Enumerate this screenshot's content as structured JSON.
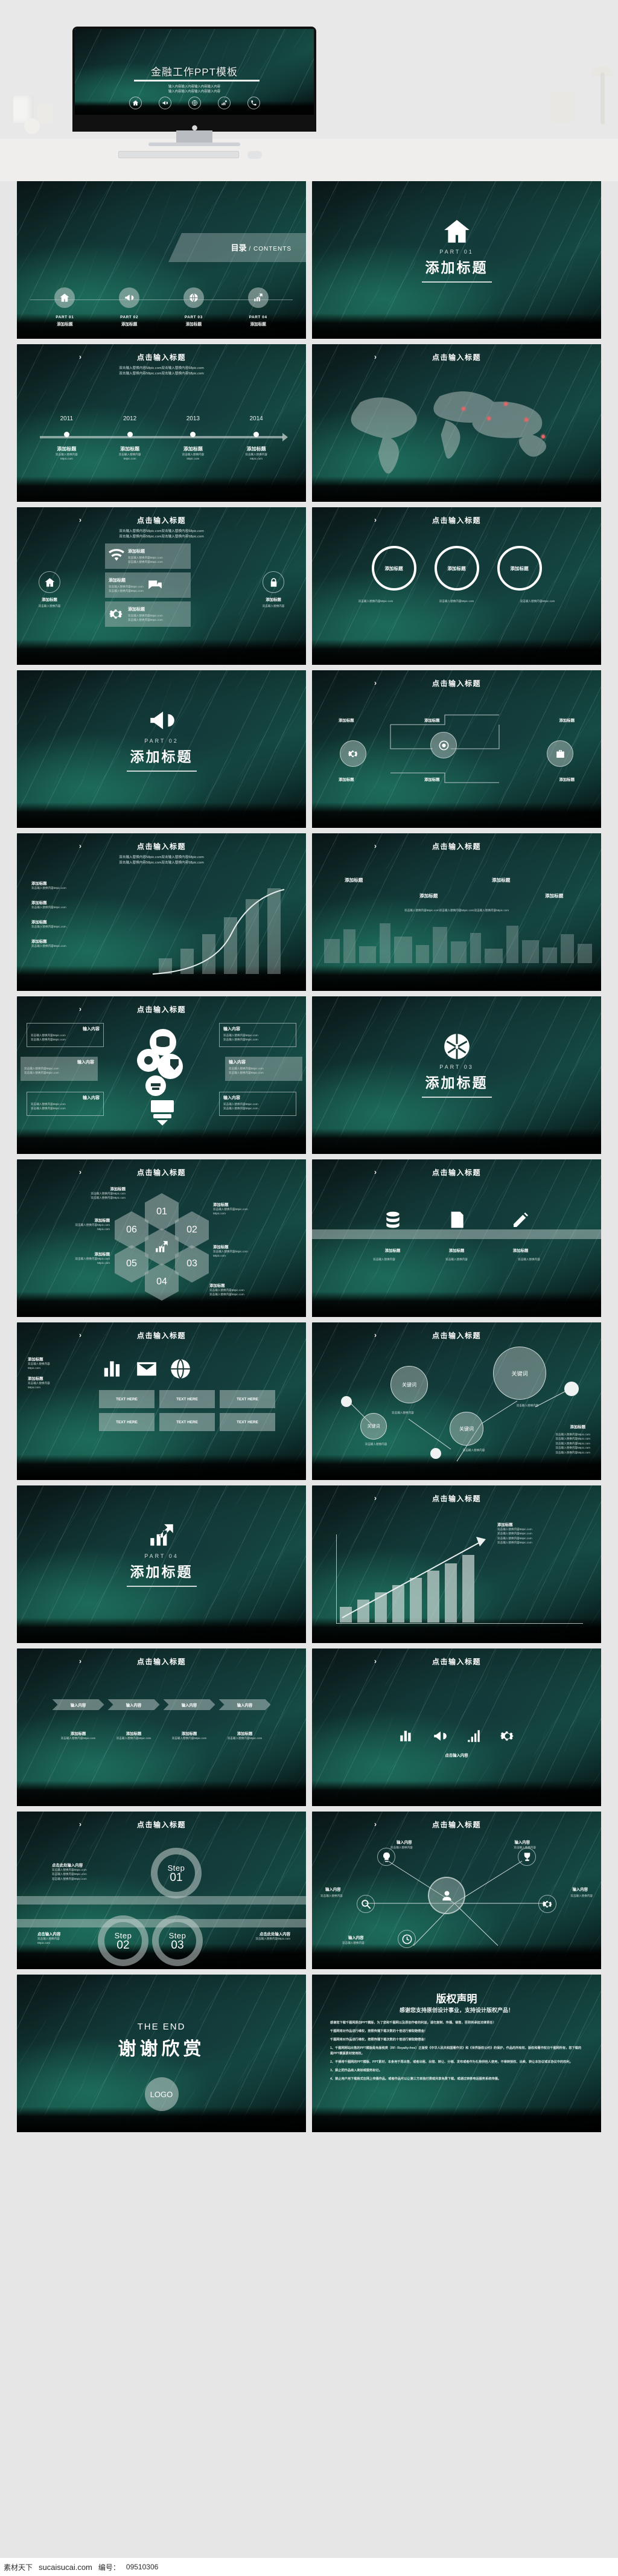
{
  "hero": {
    "title": "金融工作PPT模板",
    "subtitle_line1": "输入内容输入内容输入内容输入内容",
    "subtitle_line2": "输入内容输入内容输入内容输入内容",
    "icons": [
      "home-icon",
      "megaphone-icon",
      "network-globe-icon",
      "growth-chart-icon",
      "phone-icon"
    ]
  },
  "common": {
    "slide_title": "点击输入标题",
    "body_text": "双击输入替换内容58pic.com双击输入替换内容58pic.com",
    "body_text_short": "双击输入替换内容",
    "site": "58pic.com",
    "add_title": "添加标题",
    "input_content": "输入内容",
    "keyword": "关键词",
    "click_here_input": "点击此处输入内容",
    "click_input": "点击输入内容"
  },
  "contents": {
    "heading_cn": "目录",
    "heading_sep": " / ",
    "heading_en": "CONTENTS",
    "items": [
      {
        "part": "PART 01",
        "label": "添加标题",
        "icon": "home-icon"
      },
      {
        "part": "PART 02",
        "label": "添加标题",
        "icon": "megaphone-icon"
      },
      {
        "part": "PART 03",
        "label": "添加标题",
        "icon": "network-globe-icon"
      },
      {
        "part": "PART 04",
        "label": "添加标题",
        "icon": "growth-chart-icon"
      }
    ]
  },
  "sections": [
    {
      "part": "PART 01",
      "title": "添加标题",
      "icon": "home-icon"
    },
    {
      "part": "PART 02",
      "title": "添加标题",
      "icon": "megaphone-icon"
    },
    {
      "part": "PART 03",
      "title": "添加标题",
      "icon": "network-globe-icon"
    },
    {
      "part": "PART 04",
      "title": "添加标题",
      "icon": "growth-chart-icon"
    }
  ],
  "timeline": {
    "title": "点击输入标题",
    "sub1": "双击输入替换内容58pic.com双击输入替换内容58pic.com",
    "sub2": "双击输入替换内容58pic.com双击输入替换内容58pic.com",
    "years": [
      "2011",
      "2012",
      "2013",
      "2014"
    ],
    "labels": [
      "添加标题",
      "添加标题",
      "添加标题",
      "添加标题"
    ],
    "captions": [
      "双击输入替换内容",
      "双击输入替换内容",
      "双击输入替换内容",
      "双击输入替换内容"
    ]
  },
  "map_slide": {
    "title": "点击输入标题",
    "pins": 5
  },
  "three_circles": {
    "title": "点击输入标题",
    "circles": [
      "添加标题",
      "添加标题",
      "添加标题"
    ],
    "captions": [
      "双击输入替换内容58pic.com",
      "双击输入替换内容58pic.com",
      "双击输入替换内容58pic.com"
    ]
  },
  "feature_cards": {
    "title": "点击输入标题",
    "cards": [
      {
        "heading": "添加标题",
        "line1": "双击输入替换内容58pic.com",
        "line2": "双击输入替换内容58pic.com",
        "icon": "wifi-icon"
      },
      {
        "heading": "添加标题",
        "line1": "双击输入替换内容58pic.com",
        "line2": "双击输入替换内容58pic.com",
        "icon": "chat-icon"
      },
      {
        "heading": "添加标题",
        "line1": "双击输入替换内容58pic.com",
        "line2": "双击输入替换内容58pic.com",
        "icon": "gear-icon"
      }
    ],
    "side_left": {
      "icon": "home-icon",
      "label": "添加标题"
    },
    "side_right": {
      "icon": "lock-icon",
      "label": "添加标题"
    }
  },
  "gear_flow": {
    "title": "点击输入标题",
    "nodes": [
      "添加标题",
      "添加标题",
      "添加标题",
      "添加标题",
      "添加标题",
      "添加标题"
    ],
    "icons": [
      "gear-icon",
      "briefcase-icon",
      "chart-icon",
      "target-icon"
    ]
  },
  "growth_steps": {
    "title": "点击输入标题",
    "steps": [
      "添加标题",
      "添加标题",
      "添加标题",
      "添加标题"
    ],
    "captions": [
      "双击输入替换内容58pic.com",
      "双击输入替换内容58pic.com",
      "双击输入替换内容58pic.com",
      "双击输入替换内容58pic.com"
    ]
  },
  "city_slide": {
    "title": "点击输入标题",
    "tags": [
      "添加标题",
      "添加标题",
      "添加标题",
      "添加标题"
    ],
    "body": "双击输入替换内容58pic.com双击输入替换内容58pic.com双击输入替换内容58pic.com"
  },
  "bulb_slide": {
    "title": "点击输入标题",
    "cards": [
      {
        "heading": "输入内容",
        "line1": "双击输入替换内容58pic.com",
        "line2": "双击输入替换内容58pic.com"
      },
      {
        "heading": "输入内容",
        "line1": "双击输入替换内容58pic.com",
        "line2": "双击输入替换内容58pic.com"
      },
      {
        "heading": "输入内容",
        "line1": "双击输入替换内容58pic.com",
        "line2": "双击输入替换内容58pic.com"
      },
      {
        "heading": "输入内容",
        "line1": "双击输入替换内容58pic.com",
        "line2": "双击输入替换内容58pic.com"
      },
      {
        "heading": "输入内容",
        "line1": "双击输入替换内容58pic.com",
        "line2": "双击输入替换内容58pic.com"
      },
      {
        "heading": "输入内容",
        "line1": "双击输入替换内容58pic.com",
        "line2": "双击输入替换内容58pic.com"
      }
    ]
  },
  "hex_slide": {
    "title": "点击输入标题",
    "numbers": [
      "01",
      "02",
      "03",
      "04",
      "05",
      "06"
    ],
    "labels": [
      "添加标题",
      "添加标题",
      "添加标题",
      "添加标题",
      "添加标题",
      "添加标题"
    ],
    "captions": [
      "双击输入替换内容58pic.com",
      "双击输入替换内容58pic.com",
      "双击输入替换内容58pic.com",
      "双击输入替换内容58pic.com",
      "双击输入替换内容58pic.com",
      "双击输入替换内容58pic.com"
    ],
    "center_icon": "growth-chart-icon"
  },
  "band_icons": {
    "title": "点击输入标题",
    "items": [
      {
        "icon": "database-icon",
        "label": "添加标题"
      },
      {
        "icon": "document-icon",
        "label": "添加标题"
      },
      {
        "icon": "pencil-icon",
        "label": "添加标题"
      }
    ]
  },
  "text_grid": {
    "title": "点击输入标题",
    "left_heading": "添加标题",
    "left_lines": [
      "双击输入替换内容",
      "58pic.com",
      "双击输入替换内容",
      "58pic.com"
    ],
    "cells": [
      "TEXT HERE",
      "TEXT HERE",
      "TEXT HERE",
      "TEXT HERE",
      "TEXT HERE",
      "TEXT HERE"
    ],
    "icons": [
      "chart-icon",
      "mail-icon",
      "globe-icon"
    ]
  },
  "bubbles": {
    "title": "点击输入标题",
    "nodes": [
      "关键词",
      "关键词",
      "关键词",
      "关键词"
    ],
    "captions": [
      "双击输入替换内容",
      "双击输入替换内容",
      "双击输入替换内容",
      "双击输入替换内容"
    ],
    "site": "58pic.com",
    "side_heading": "添加标题",
    "side_lines": [
      "双击输入替换内容58pic.com",
      "双击输入替换内容58pic.com",
      "双击输入替换内容58pic.com",
      "双击输入替换内容58pic.com",
      "双击输入替换内容58pic.com"
    ]
  },
  "bar_chart": {
    "title": "点击输入标题",
    "heading": "添加标题",
    "lines": [
      "双击输入替换内容58pic.com",
      "双击输入替换内容58pic.com",
      "双击输入替换内容58pic.com",
      "双击输入替换内容58pic.com"
    ]
  },
  "arrows": {
    "title": "点击输入标题",
    "chips": [
      "输入内容",
      "输入内容",
      "输入内容",
      "输入内容"
    ],
    "headings": [
      "添加标题",
      "添加标题",
      "添加标题",
      "添加标题"
    ],
    "captions": [
      "双击输入替换内容58pic.com",
      "双击输入替换内容58pic.com",
      "双击输入替换内容58pic.com",
      "双击输入替换内容58pic.com"
    ]
  },
  "icon_row": {
    "title": "点击输入标题",
    "caption": "点击输入内容",
    "icons": [
      "chart-icon",
      "megaphone-icon",
      "bars-icon",
      "gear-icon"
    ]
  },
  "steps": {
    "title": "点击输入标题",
    "items": [
      {
        "word": "Step",
        "num": "01",
        "heading": "点击此处输入内容",
        "lines": [
          "双击输入替换内容58pic.com",
          "双击输入替换内容58pic.com",
          "双击输入替换内容58pic.com"
        ]
      },
      {
        "word": "Step",
        "num": "02",
        "heading": "点击输入内容",
        "lines": [
          "双击输入替换内容",
          "58pic.com"
        ]
      },
      {
        "word": "Step",
        "num": "03",
        "heading": "点击此处输入内容",
        "lines": [
          "双击输入替换内容58pic.com"
        ]
      }
    ]
  },
  "radial": {
    "title": "点击输入标题",
    "center_icon": "user-icon",
    "nodes": [
      "输入内容",
      "输入内容",
      "输入内容",
      "输入内容",
      "输入内容"
    ],
    "captions": [
      "双击输入替换内容",
      "双击输入替换内容",
      "双击输入替换内容",
      "双击输入替换内容",
      "双击输入替换内容"
    ]
  },
  "end": {
    "en": "THE END",
    "cn": "谢谢欣赏",
    "logo": "LOGO"
  },
  "copyright": {
    "title": "版权声明",
    "subtitle": "感谢您支持原创设计事业，支持设计版权产品！",
    "paragraphs": [
      "感谢您下载千图网原创PPT模版，为了您和千图网以及原创作者的利益，请勿复制、传播、销售，否则将承担法律责任！",
      "千图网将对作品进行维权，按照传播下载次数的十倍进行索取赔偿金！",
      "1、千图网网站出售的PPT模版是免版税类（RF: Royalty-free）正版受《中华人民共和国著作法》和《世界版权公约》的保护，作品的所有权、版权和著作权日千图网所有，您下载的是PPT模版素材使用权。",
      "2、不得将千图网的PPT模版、PPT素材，本身用于再出售，或者出租、出借、转让、分销、发布或者作为礼物供他人使用，不得转授权、出卖、转让本协议或本协议中的权利。",
      "3、禁止把作品纳入商标或服务标记。",
      "4、禁止用户用下载格式在网上传播作品。或者作品可以让第三方单独付费或共享免费下载。或通过转移电话服务系统传播。"
    ]
  },
  "footer": {
    "brand": "素材天下",
    "site": "sucaisucai.com",
    "id_label": "编号：",
    "id": "09510306"
  }
}
